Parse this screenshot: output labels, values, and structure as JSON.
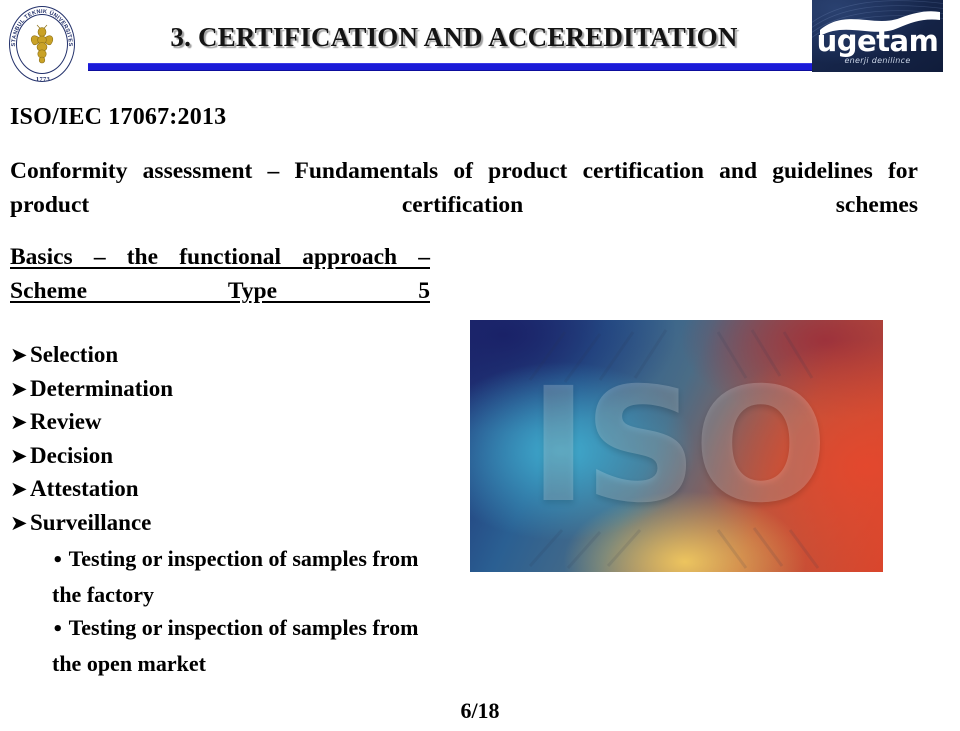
{
  "header": {
    "title": "3. CERTIFICATION AND ACCEREDITATION",
    "accent_color": "#1b1bd8",
    "left_logo": {
      "icon": "itu-bee-seal-icon",
      "ring_text": "ISTANBUL TEKNIK UNIVERSITESI",
      "year": "1773"
    },
    "right_logo": {
      "brand": "ugetam",
      "tagline": "enerji denilince",
      "background_color": "#16264b"
    }
  },
  "content": {
    "standard_code": "ISO/IEC 17067:2013",
    "standard_title": "Conformity assessment – Fundamentals of product certification and guidelines for product certification schemes",
    "section_heading": "Basics – the functional approach – Scheme Type 5",
    "bullets": [
      {
        "marker": "➤",
        "label": "Selection"
      },
      {
        "marker": "➤",
        "label": "Determination"
      },
      {
        "marker": "➤",
        "label": "Review"
      },
      {
        "marker": "➤",
        "label": "Decision"
      },
      {
        "marker": "➤",
        "label": "Attestation"
      },
      {
        "marker": "➤",
        "label": "Surveillance"
      }
    ],
    "sub_bullets": [
      {
        "marker": "•",
        "text": "Testing or inspection of samples from the factory"
      },
      {
        "marker": "•",
        "text": "Testing or inspection of samples from the open market"
      }
    ],
    "illustration": {
      "word": "ISO",
      "alt": "Colorful gradient background with large translucent ISO lettering"
    }
  },
  "footer": {
    "page_number": "6/18"
  }
}
